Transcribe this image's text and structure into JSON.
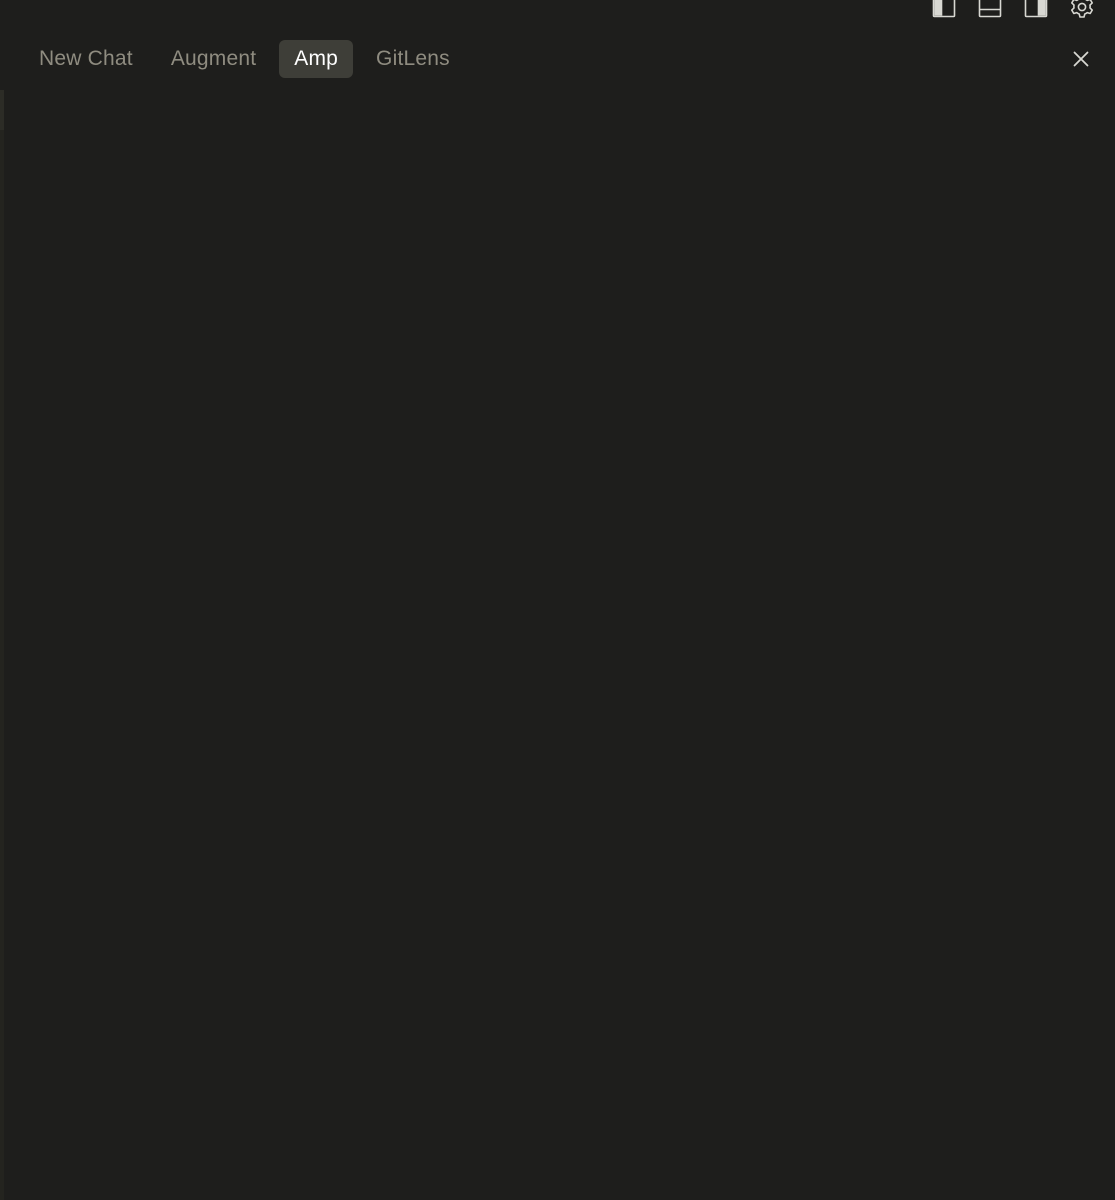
{
  "tabs": [
    {
      "label": "New Chat",
      "active": false
    },
    {
      "label": "Augment",
      "active": false
    },
    {
      "label": "Amp",
      "active": true
    },
    {
      "label": "GitLens",
      "active": false
    }
  ],
  "toolbar": {
    "icons": [
      "toggle-primary-sidebar-icon",
      "toggle-panel-icon",
      "toggle-secondary-sidebar-icon",
      "gear-icon"
    ]
  },
  "close_icon": "close-icon",
  "colors": {
    "background": "#1e1e1c",
    "active_tab_bg": "#3e3e38",
    "inactive_tab_text": "#8f8c80",
    "active_tab_text": "#ffffff",
    "icon": "#d8d8d2"
  }
}
